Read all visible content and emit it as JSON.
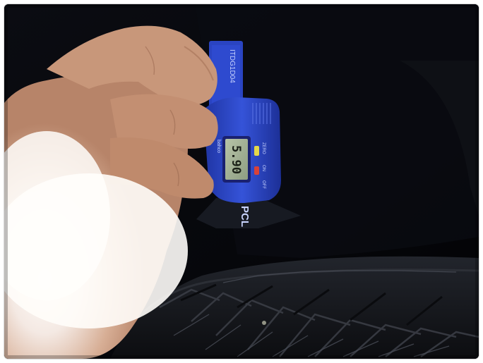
{
  "photo": {
    "subject": "tire-tread-depth-measurement",
    "gauge": {
      "model_label": "ITDG1D04",
      "small_label": "",
      "brand_label": "PCL",
      "maker_label": "bahco",
      "reading": "5.90",
      "zero_label": "ZERO",
      "on_label": "ON",
      "off_label": "OFF",
      "body_color": "#2e48c9",
      "lcd_color": "#a9b79a",
      "on_color": "#d8423a",
      "zero_color": "#e3d74a"
    },
    "colors": {
      "background": "#05060a",
      "tire": "#16181d",
      "skin": "#d2a58a",
      "glare": "#fbf7f4"
    }
  }
}
